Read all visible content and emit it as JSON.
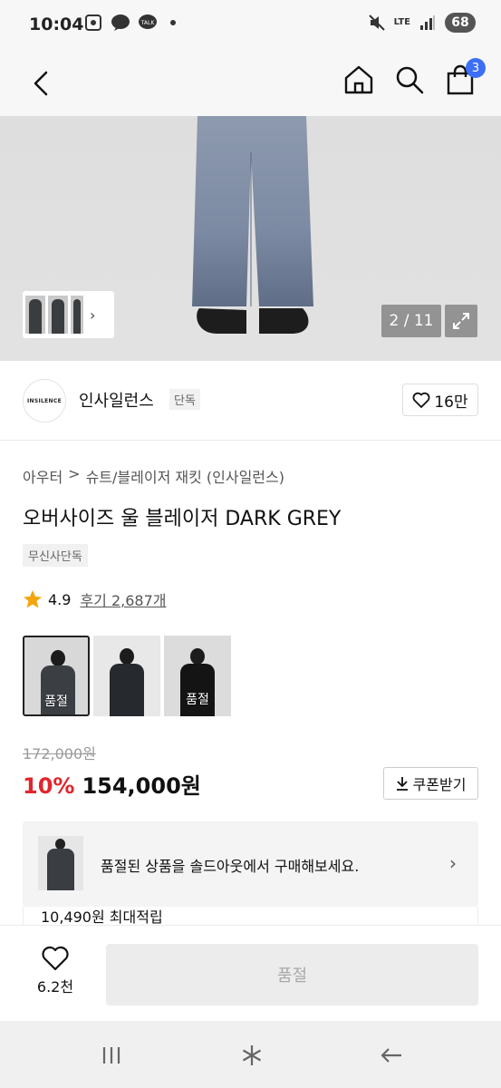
{
  "status_bar": {
    "time": "10:04",
    "network": "LTE",
    "battery": "68"
  },
  "header": {
    "cart_count": "3"
  },
  "gallery": {
    "counter": "2 / 11"
  },
  "brand": {
    "logo_text": "INSILENCE",
    "name": "인사일런스",
    "tag": "단독",
    "likes": "16만"
  },
  "breadcrumb": {
    "items": [
      "아우터",
      ">",
      "슈트/블레이저 재킷 (인사일런스)"
    ]
  },
  "product": {
    "title": "오버사이즈 울 블레이저 DARK GREY",
    "tag": "무신사단독",
    "rating": "4.9",
    "reviews": "후기 2,687개",
    "rating_value": 4.9
  },
  "options": [
    {
      "label": "품절",
      "selected": true
    },
    {
      "label": "",
      "selected": false
    },
    {
      "label": "품절",
      "selected": false
    }
  ],
  "price": {
    "original": "172,000원",
    "discount": "10%",
    "sale": "154,000원",
    "coupon_label": "쿠폰받기"
  },
  "soldout_banner": {
    "text": "품절된 상품을 솔드아웃에서 구매해보세요."
  },
  "points": {
    "text": "10,490원 최대적립"
  },
  "action_bar": {
    "wish_count": "6.2천",
    "soldout_label": "품절"
  },
  "colors": {
    "accent": "#3d6ff5",
    "discount": "#e0262c",
    "star": "#f2a50c"
  }
}
